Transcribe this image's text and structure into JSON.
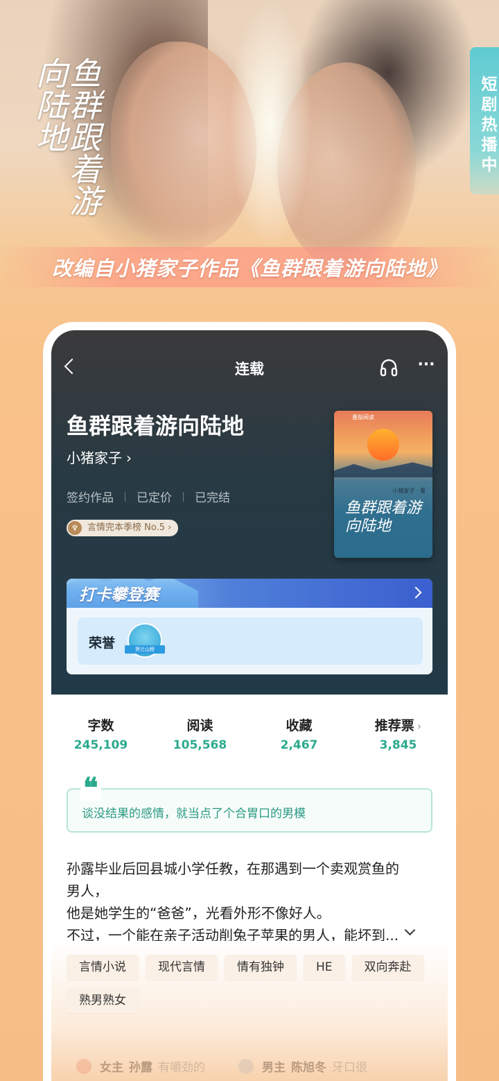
{
  "poster": {
    "calligraphy_title": "鱼群跟着游向陆地",
    "subtitle": "改编自小猪家子作品《鱼群跟着游向陆地》",
    "side_tag": "短剧热播中"
  },
  "topbar": {
    "title": "连载"
  },
  "book": {
    "title": "鱼群跟着游向陆地",
    "author": "小猪家子",
    "meta": [
      "签约作品",
      "已定价",
      "已完结"
    ],
    "rank_badge": "言情完本季榜 No.5",
    "cover": {
      "brand": "番茄阅读",
      "author": "小猪家子 · 著",
      "title": "鱼群跟着游向陆地"
    }
  },
  "climb": {
    "title": "打卡攀登赛",
    "honor_label": "荣誉",
    "medal_text": "贺兰山榜"
  },
  "stats": [
    {
      "label": "字数",
      "value": "245,109"
    },
    {
      "label": "阅读",
      "value": "105,568"
    },
    {
      "label": "收藏",
      "value": "2,467"
    },
    {
      "label": "推荐票",
      "value": "3,845"
    }
  ],
  "quote": {
    "mark": "❝",
    "text": "谈没结果的感情，就当点了个合胃口的男模"
  },
  "synopsis": {
    "lines": [
      "孙露毕业后回县城小学任教，在那遇到一个卖观赏鱼的",
      "男人，",
      "他是她学生的“爸爸”，光看外形不像好人。",
      "不过，一个能在亲子活动削兔子苹果的男人，能坏到..."
    ]
  },
  "tags": [
    "言情小说",
    "现代言情",
    "情有独钟",
    "HE",
    "双向奔赴",
    "熟男熟女"
  ],
  "roles": [
    {
      "type": "女主",
      "name": "孙露",
      "desc": "有嚼劲的"
    },
    {
      "type": "男主",
      "name": "陈旭冬",
      "desc": "牙口很"
    }
  ],
  "colors": {
    "accent_green": "#2baa8e",
    "header_dark": "#213a47",
    "side_tag": "#5fcbd3",
    "background_peach": "#f8c38c"
  }
}
